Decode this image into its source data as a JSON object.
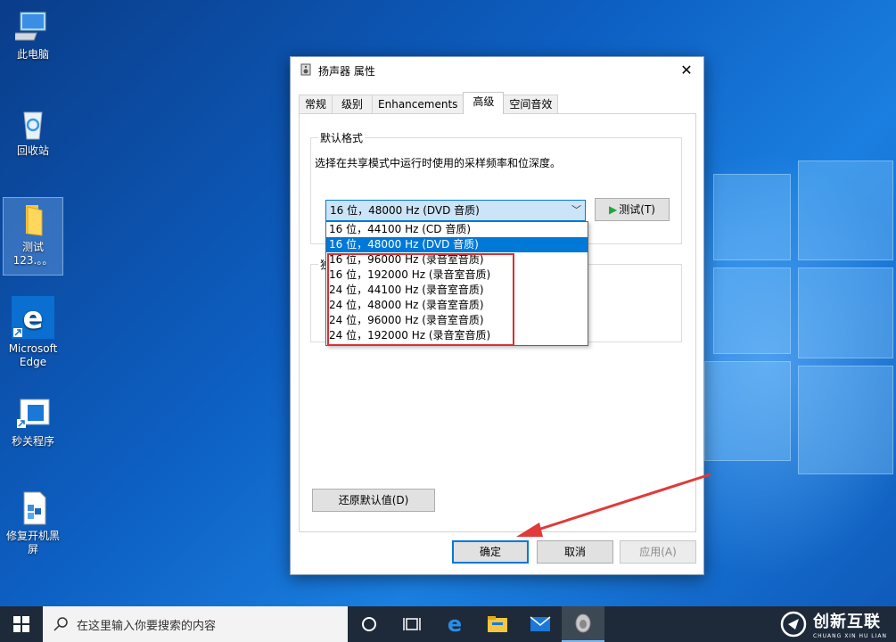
{
  "desktop": {
    "icons": [
      {
        "label": "此电脑"
      },
      {
        "label": "回收站"
      },
      {
        "label": "测试123.。。"
      },
      {
        "label": "Microsoft Edge"
      },
      {
        "label": "秒关程序"
      },
      {
        "label": "修复开机黑屏"
      }
    ]
  },
  "dialog": {
    "title": "扬声器 属性",
    "close_label": "✕",
    "tabs": [
      {
        "label": "常规"
      },
      {
        "label": "级别"
      },
      {
        "label": "Enhancements"
      },
      {
        "label": "高级"
      },
      {
        "label": "空间音效"
      }
    ],
    "active_tab": "高级",
    "default_format": {
      "group_title": "默认格式",
      "description": "选择在共享模式中运行时使用的采样频率和位深度。",
      "selected_value": "16 位，48000 Hz (DVD 音质)",
      "test_label": "测试(T)",
      "options": [
        "16 位，44100 Hz (CD 音质)",
        "16 位，48000 Hz (DVD 音质)",
        "16 位，96000 Hz (录音室音质)",
        "16 位，192000 Hz (录音室音质)",
        "24 位，44100 Hz (录音室音质)",
        "24 位，48000 Hz (录音室音质)",
        "24 位，96000 Hz (录音室音质)",
        "24 位，192000 Hz (录音室音质)"
      ],
      "selected_index": 1
    },
    "exclusive_group_title": "独",
    "restore_label": "还原默认值(D)",
    "ok_label": "确定",
    "cancel_label": "取消",
    "apply_label": "应用(A)"
  },
  "taskbar": {
    "search_placeholder": "在这里输入你要搜索的内容"
  },
  "watermark": {
    "main": "创新互联",
    "sub": "CHUANG XIN HU LIAN"
  },
  "colors": {
    "accent": "#0078d7",
    "highlight_box": "#d93030"
  }
}
